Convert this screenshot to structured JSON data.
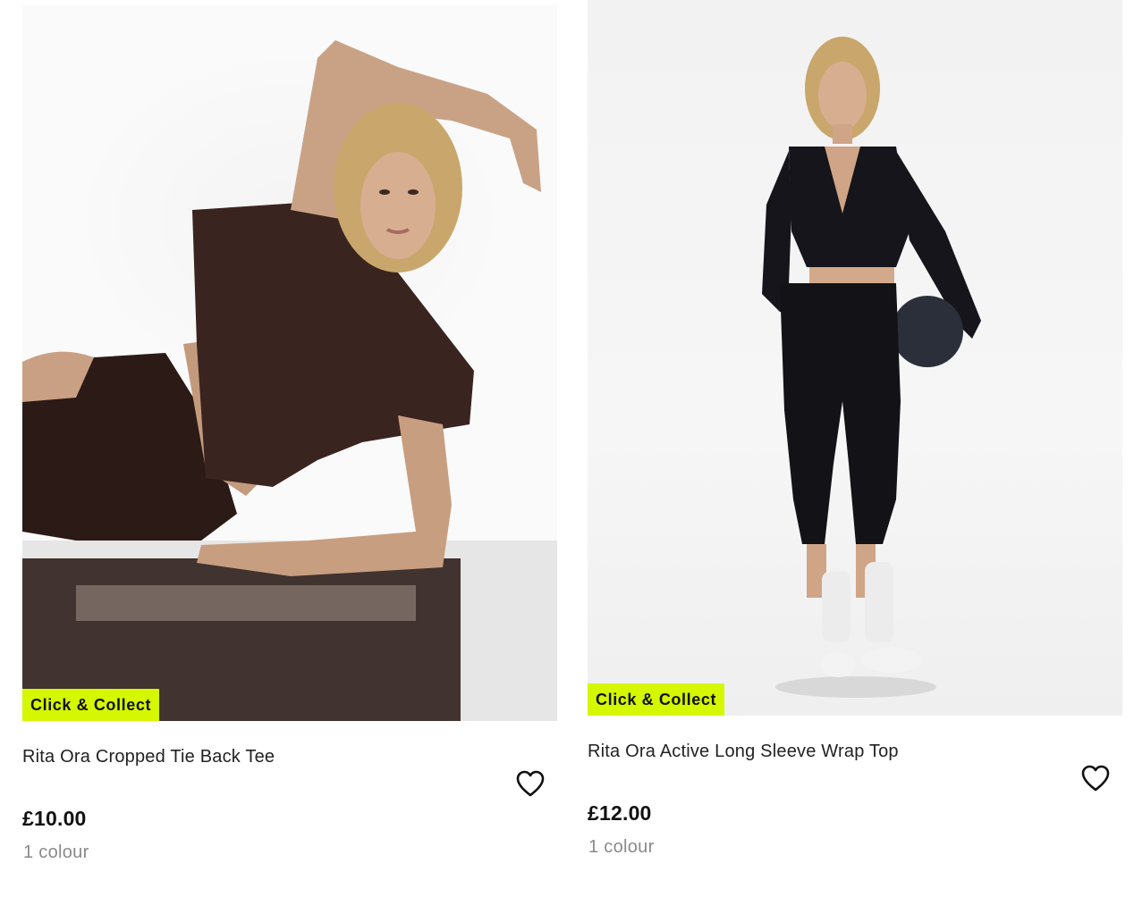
{
  "products": [
    {
      "badge": "Click & Collect",
      "title": "Rita Ora Cropped Tie Back Tee",
      "price": "£10.00",
      "colours": "1 colour",
      "wishlist_icon": "heart-outline-icon"
    },
    {
      "badge": "Click & Collect",
      "title": "Rita Ora Active Long Sleeve Wrap Top",
      "price": "£12.00",
      "colours": "1 colour",
      "wishlist_icon": "heart-outline-icon"
    }
  ],
  "colors": {
    "badge_background": "#d5f700",
    "price_text": "#111111",
    "colour_count_text": "#8a8a8a"
  }
}
